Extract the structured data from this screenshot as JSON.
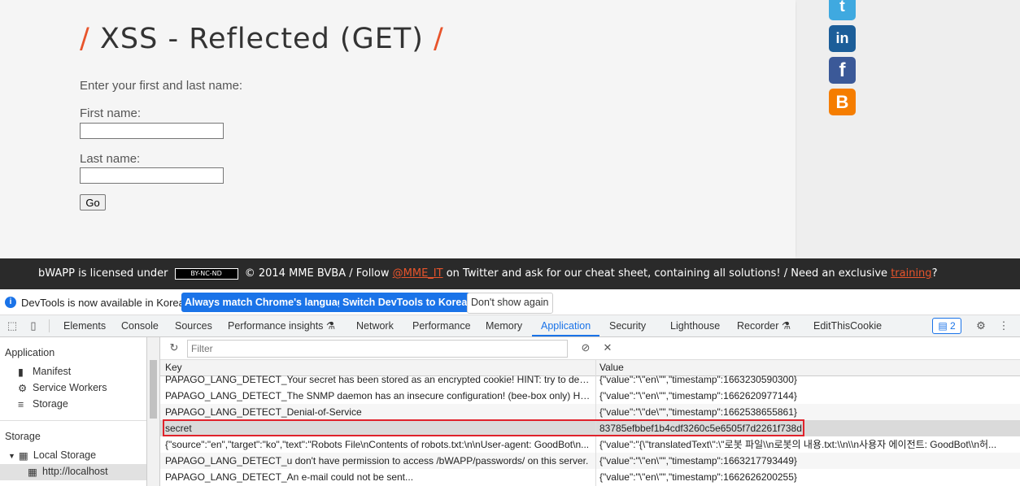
{
  "page": {
    "title_slash": "/",
    "title_text": "XSS - Reflected (GET)",
    "prompt": "Enter your first and last name:",
    "first_name_label": "First name:",
    "last_name_label": "Last name:",
    "first_name_value": "",
    "last_name_value": "",
    "go_label": "Go",
    "social": [
      "twitter-icon",
      "linkedin-icon",
      "facebook-icon",
      "blogger-icon"
    ]
  },
  "footer": {
    "prefix": "bWAPP is licensed under",
    "cc_badge": "BY-NC-ND",
    "middle": "© 2014 MME BVBA / Follow",
    "handle": "@MME_IT",
    "after_handle": "on Twitter and ask for our cheat sheet, containing all solutions! / Need an exclusive",
    "training": "training",
    "end": "?"
  },
  "devtools_notice": {
    "text": "DevTools is now available in Korean!",
    "btn_match": "Always match Chrome's language",
    "btn_switch": "Switch DevTools to Korean",
    "btn_dismiss": "Don't show again"
  },
  "tabs": [
    "Elements",
    "Console",
    "Sources",
    "Performance insights",
    "Network",
    "Performance",
    "Memory",
    "Application",
    "Security",
    "Lighthouse",
    "Recorder",
    "EditThisCookie"
  ],
  "active_tab": "Application",
  "message_count": "2",
  "sidebar": {
    "application_header": "Application",
    "manifest": "Manifest",
    "service_workers": "Service Workers",
    "storage": "Storage",
    "storage_header": "Storage",
    "local_storage": "Local Storage",
    "localhost": "http://localhost"
  },
  "filter_placeholder": "Filter",
  "grid": {
    "col_key": "Key",
    "col_value": "Value",
    "rows": [
      {
        "key": "PAPAGO_LANG_DETECT_Your secret has been stored as an encrypted cookie! HINT: try to decrypt...",
        "value": "{\"value\":\"\\\"en\\\"\",\"timestamp\":1663230590300}"
      },
      {
        "key": "PAPAGO_LANG_DETECT_The SNMP daemon has an insecure configuration! (bee-box only) HINT: t...",
        "value": "{\"value\":\"\\\"en\\\"\",\"timestamp\":1662620977144}"
      },
      {
        "key": "PAPAGO_LANG_DETECT_Denial-of-Service",
        "value": "{\"value\":\"\\\"de\\\"\",\"timestamp\":1662538655861}"
      },
      {
        "key": "secret",
        "value": "83785efbbef1b4cdf3260c5e6505f7d2261f738d"
      },
      {
        "key": "{\"source\":\"en\",\"target\":\"ko\",\"text\":\"Robots File\\nContents of robots.txt:\\n\\nUser-agent: GoodBot\\n...",
        "value": "{\"value\":\"{\\\"translatedText\\\":\\\"로봇 파일\\\\n로봇의 내용.txt:\\\\n\\\\n사용자 에이전트: GoodBot\\\\n허..."
      },
      {
        "key": "PAPAGO_LANG_DETECT_u don't have permission to access /bWAPP/passwords/ on this server.",
        "value": "{\"value\":\"\\\"en\\\"\",\"timestamp\":1663217793449}"
      },
      {
        "key": "PAPAGO_LANG_DETECT_An e-mail could not be sent...",
        "value": "{\"value\":\"\\\"en\\\"\",\"timestamp\":1662626200255}"
      }
    ]
  }
}
